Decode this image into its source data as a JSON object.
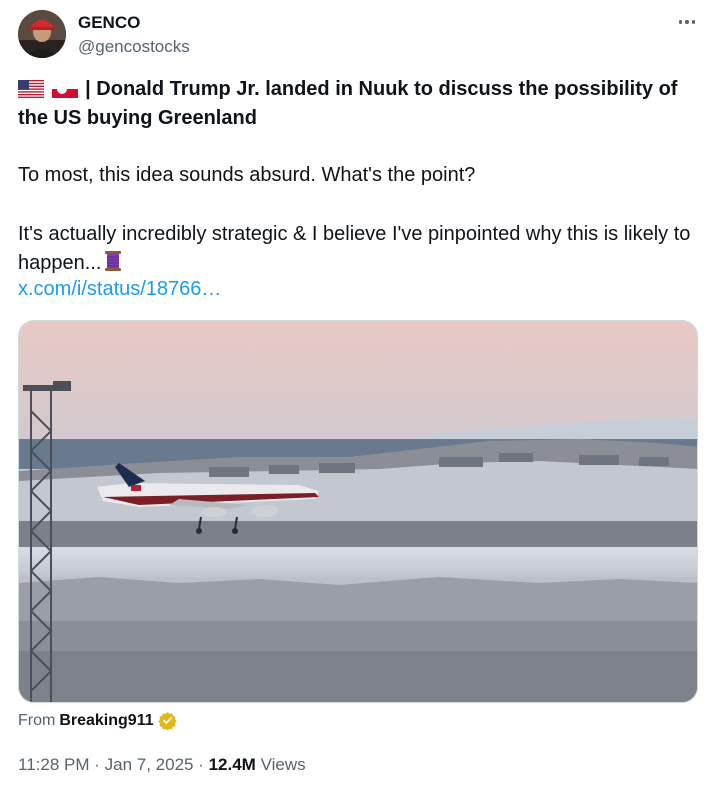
{
  "author": {
    "name": "GENCO",
    "handle": "@gencostocks"
  },
  "tweet": {
    "headline": "| Donald Trump Jr. landed in Nuuk to discuss the possibility of the US buying Greenland",
    "para1": "To most, this idea sounds absurd. What's the point?",
    "para2": "It's actually incredibly strategic & I believe I've pinpointed why this is likely to happen...",
    "link": "x.com/i/status/18766…"
  },
  "media": {
    "icon": "video-thumbnail-plane-landing"
  },
  "source": {
    "prefix": "From",
    "name": "Breaking911"
  },
  "meta": {
    "time": "11:28 PM",
    "sep1": " · ",
    "date": "Jan 7, 2025",
    "sep2": " · ",
    "views_count": "12.4M",
    "views_label": " Views"
  },
  "colors": {
    "accent": "#1d9bf0",
    "muted": "#536471",
    "verified_gold": "#e2b719"
  }
}
